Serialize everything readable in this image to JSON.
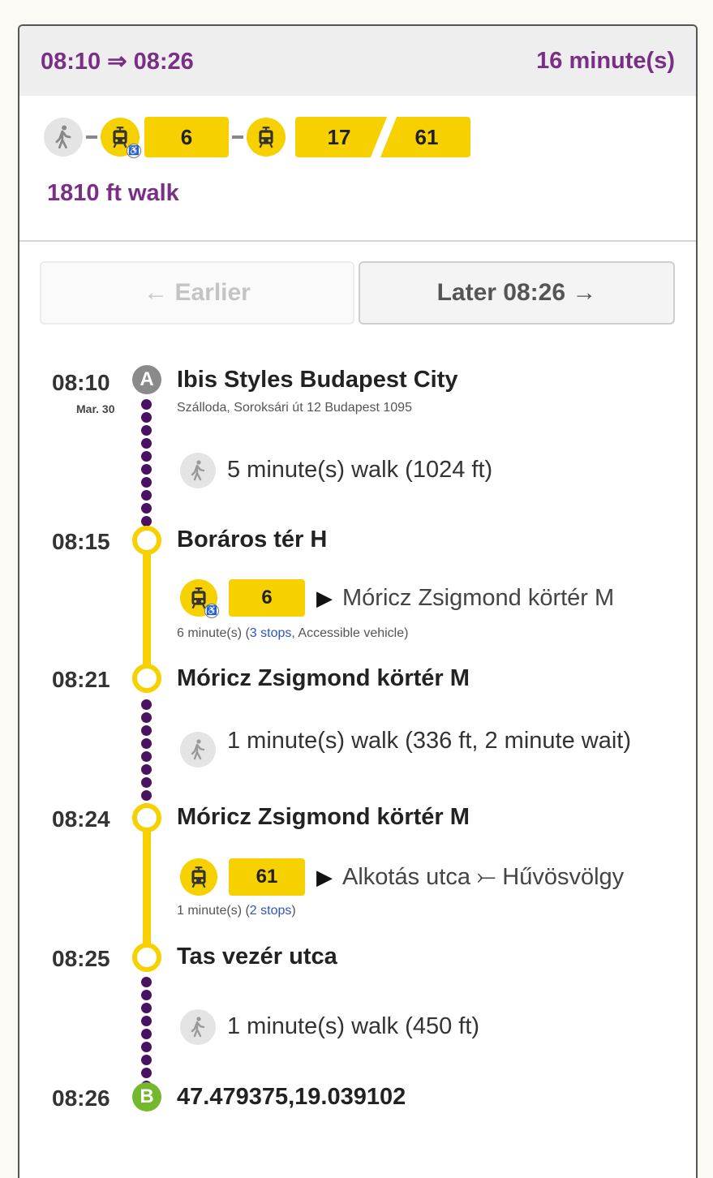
{
  "header": {
    "times": "08:10 ⇒ 08:26",
    "duration": "16 minute(s)"
  },
  "summary": {
    "icons": [
      "walk-icon",
      "tram-icon",
      "tram-icon"
    ],
    "route_6": "6",
    "route_17": "17",
    "route_61": "61",
    "walk_distance": "1810 ft walk"
  },
  "navigation": {
    "earlier_label": "← Earlier",
    "later_label": "Later 08:26 →"
  },
  "itinerary": {
    "start": {
      "time": "08:10",
      "date": "Mar. 30",
      "marker": "A",
      "name": "Ibis Styles Budapest City",
      "address": "Szálloda, Soroksári út 12 Budapest 1095"
    },
    "walk1": "5 minute(s) walk (1024 ft)",
    "stop1": {
      "time": "08:15",
      "name": "Boráros tér H"
    },
    "trip1": {
      "route": "6",
      "direction": "Móricz Zsigmond körtér M",
      "duration": "6 minute(s) (",
      "stops": "3 stops",
      "extra": ", Accessible vehicle)"
    },
    "stop2": {
      "time": "08:21",
      "name": "Móricz Zsigmond körtér M"
    },
    "walk2": "1 minute(s) walk (336 ft, 2 minute wait)",
    "stop3": {
      "time": "08:24",
      "name": "Móricz Zsigmond körtér M"
    },
    "trip2": {
      "route": "61",
      "direction": "Alkotás utca ⤚ Hűvösvölgy",
      "duration": "1 minute(s) (",
      "stops": "2 stops",
      "extra": ")"
    },
    "stop4": {
      "time": "08:25",
      "name": "Tas vezér utca"
    },
    "walk3": "1 minute(s) walk (450 ft)",
    "end": {
      "time": "08:26",
      "marker": "B",
      "name": "47.479375,19.039102"
    }
  },
  "colors": {
    "accent_purple": "#7a2f86",
    "tram_yellow": "#f7d000",
    "walk_dots": "#4b1260",
    "start_marker": "#8a8a8a",
    "end_marker": "#74b82e"
  }
}
